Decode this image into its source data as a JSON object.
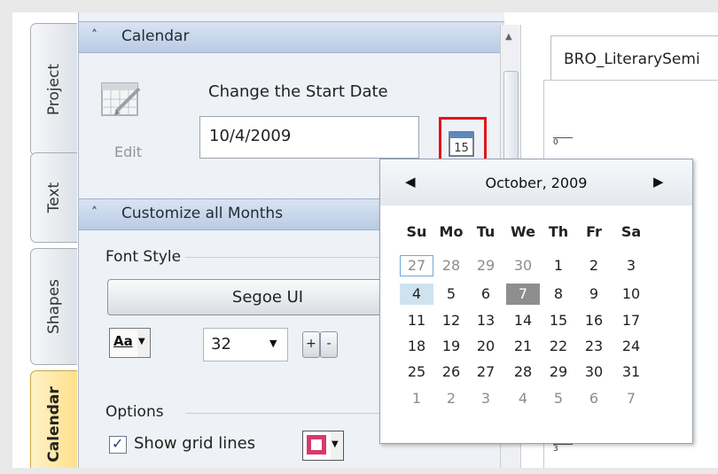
{
  "tabs": [
    {
      "label": "Project"
    },
    {
      "label": "Text"
    },
    {
      "label": "Shapes"
    },
    {
      "label": "Calendar"
    }
  ],
  "calendar_section": {
    "header": "Calendar",
    "edit_label": "Edit",
    "start_date_label": "Change the Start Date",
    "start_date_value": "10/4/2009",
    "picker_icon_text": "15"
  },
  "customize_section": {
    "header": "Customize all Months",
    "font_style_label": "Font Style",
    "font_name": "Segoe UI",
    "font_color_label": "Aa",
    "font_size": "32",
    "plus_label": "+",
    "minus_label": "-",
    "options_label": "Options",
    "show_grid_lines_label": "Show grid lines",
    "grid_color": "#d83a6b"
  },
  "document": {
    "tab_title": "BRO_LiterarySemi",
    "ruler_top": "0",
    "ruler_bottom": "3"
  },
  "date_picker": {
    "month_title": "October, 2009",
    "weekdays": [
      "Su",
      "Mo",
      "Tu",
      "We",
      "Th",
      "Fr",
      "Sa"
    ],
    "weeks": [
      [
        "27",
        "28",
        "29",
        "30",
        "1",
        "2",
        "3"
      ],
      [
        "4",
        "5",
        "6",
        "7",
        "8",
        "9",
        "10"
      ],
      [
        "11",
        "12",
        "13",
        "14",
        "15",
        "16",
        "17"
      ],
      [
        "18",
        "19",
        "20",
        "21",
        "22",
        "23",
        "24"
      ],
      [
        "25",
        "26",
        "27",
        "28",
        "29",
        "30",
        "31"
      ],
      [
        "1",
        "2",
        "3",
        "4",
        "5",
        "6",
        "7"
      ]
    ],
    "today": "27",
    "selected": "4",
    "highlighted": "7"
  }
}
